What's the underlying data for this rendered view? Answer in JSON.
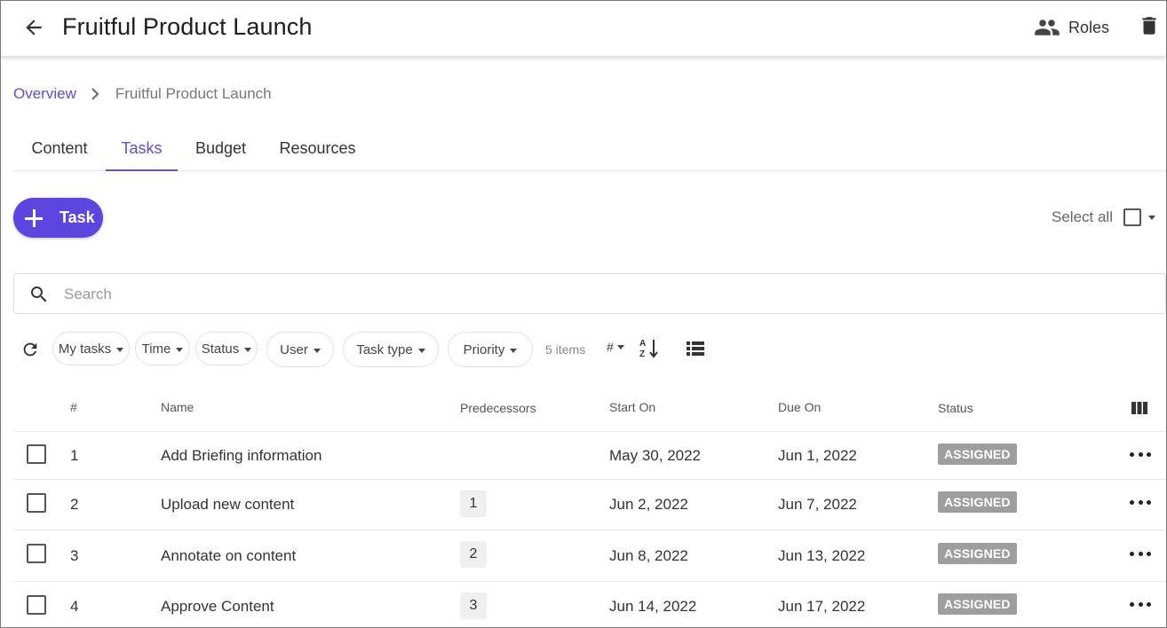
{
  "app_bar": {
    "title": "Fruitful Product Launch",
    "roles_label": "Roles"
  },
  "breadcrumb": {
    "root": "Overview",
    "current": "Fruitful Product Launch"
  },
  "tabs": [
    {
      "label": "Content",
      "active": false
    },
    {
      "label": "Tasks",
      "active": true
    },
    {
      "label": "Budget",
      "active": false
    },
    {
      "label": "Resources",
      "active": false
    }
  ],
  "toolbar": {
    "add_task_label": "Task",
    "select_all_label": "Select all"
  },
  "search": {
    "placeholder": "Search",
    "value": ""
  },
  "filters": {
    "chips": [
      "My tasks",
      "Time",
      "Status",
      "User",
      "Task type",
      "Priority"
    ],
    "items_count": "5 items",
    "sort_field": "#"
  },
  "table": {
    "columns": [
      "#",
      "Name",
      "Predecessors",
      "Start On",
      "Due On",
      "Status"
    ],
    "rows": [
      {
        "num": "1",
        "name": "Add Briefing information",
        "predecessor": "",
        "start": "May 30, 2022",
        "due": "Jun 1, 2022",
        "status": "ASSIGNED"
      },
      {
        "num": "2",
        "name": "Upload new content",
        "predecessor": "1",
        "start": "Jun 2, 2022",
        "due": "Jun 7, 2022",
        "status": "ASSIGNED"
      },
      {
        "num": "3",
        "name": "Annotate on content",
        "predecessor": "2",
        "start": "Jun 8, 2022",
        "due": "Jun 13, 2022",
        "status": "ASSIGNED"
      },
      {
        "num": "4",
        "name": "Approve Content",
        "predecessor": "3",
        "start": "Jun 14, 2022",
        "due": "Jun 17, 2022",
        "status": "ASSIGNED"
      }
    ]
  },
  "colors": {
    "accent": "#5b46e0",
    "link": "#5a4fd6",
    "status_badge": "#9e9e9e"
  }
}
